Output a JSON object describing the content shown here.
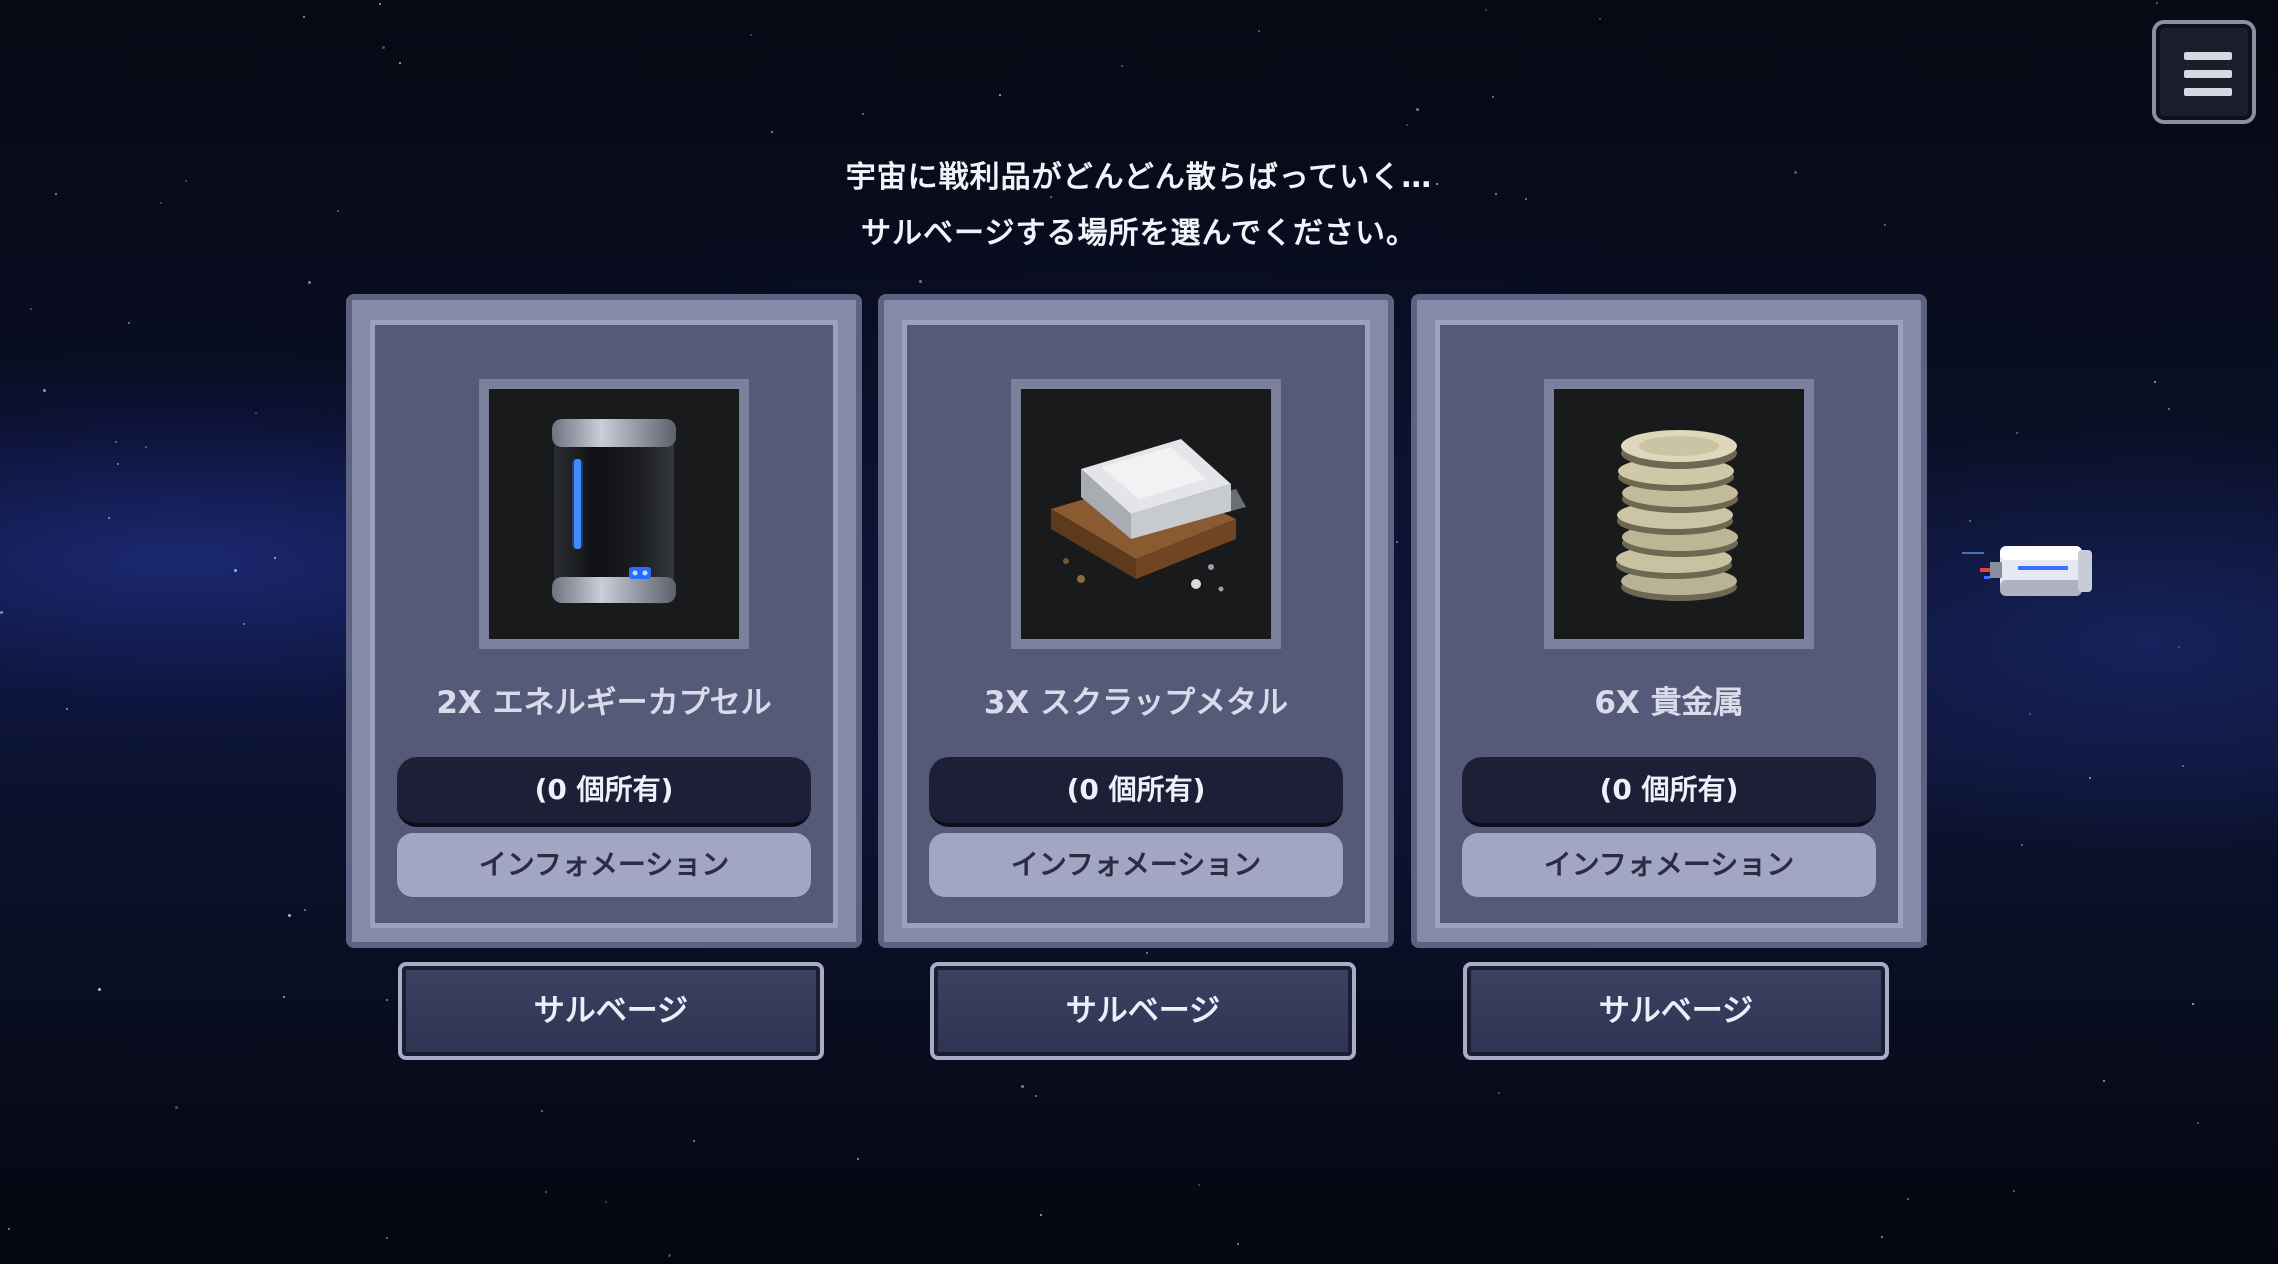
{
  "prompt": {
    "line1": "宇宙に戦利品がどんどん散らばっていく…",
    "line2": "サルベージする場所を選んでください。"
  },
  "menu": {
    "icon": "hamburger-menu-icon"
  },
  "cards": [
    {
      "icon": "energy-capsule-icon",
      "name": "2X エネルギーカプセル",
      "owned": "(0 個所有)",
      "info": "インフォメーション",
      "action": "サルベージ"
    },
    {
      "icon": "scrap-metal-icon",
      "name": "3X スクラップメタル",
      "owned": "(0 個所有)",
      "info": "インフォメーション",
      "action": "サルベージ"
    },
    {
      "icon": "precious-metal-coins-icon",
      "name": "6X 貴金属",
      "owned": "(0 個所有)",
      "info": "インフォメーション",
      "action": "サルベージ"
    }
  ],
  "ship": {
    "icon": "spaceship-icon"
  }
}
